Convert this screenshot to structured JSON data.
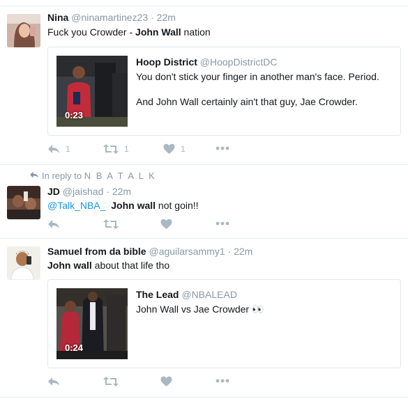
{
  "tweets": [
    {
      "name": "Nina",
      "handle": "@ninamartinez23",
      "time": "22m",
      "text_before": "Fuck you Crowder - ",
      "text_bold": "John Wall",
      "text_after": " nation",
      "quote": {
        "name": "Hoop District",
        "handle": "@HoopDistrictDC",
        "line1": "You don't stick your finger in another man's face. Period.",
        "line2": "And John Wall certainly ain't that guy, Jae Crowder.",
        "duration": "0:23"
      },
      "reply_count": "1",
      "retweet_count": "1",
      "like_count": "1"
    },
    {
      "reply_to_label": "In reply to",
      "reply_to_user": "N B A T A L K",
      "name": "JD",
      "handle": "@jaishad",
      "time": "22m",
      "mention": "@Talk_NBA_",
      "text_bold": "John wall",
      "text_after": " not goin!!"
    },
    {
      "name": "Samuel from da bible",
      "handle": "@aguilarsammy1",
      "time": "22m",
      "text_bold": "John wall",
      "text_after": " about that life tho",
      "quote": {
        "name": "The Lead",
        "handle": "@NBALEAD",
        "line1": "John Wall vs Jae Crowder 👀",
        "duration": "0:24"
      }
    }
  ],
  "separator": "·",
  "colors": {
    "link": "#1b95e0",
    "muted": "#8899a6",
    "icon": "#aab8c2",
    "border": "#e6ecf0"
  },
  "icons": [
    "reply-icon",
    "retweet-icon",
    "like-icon",
    "more-icon"
  ]
}
